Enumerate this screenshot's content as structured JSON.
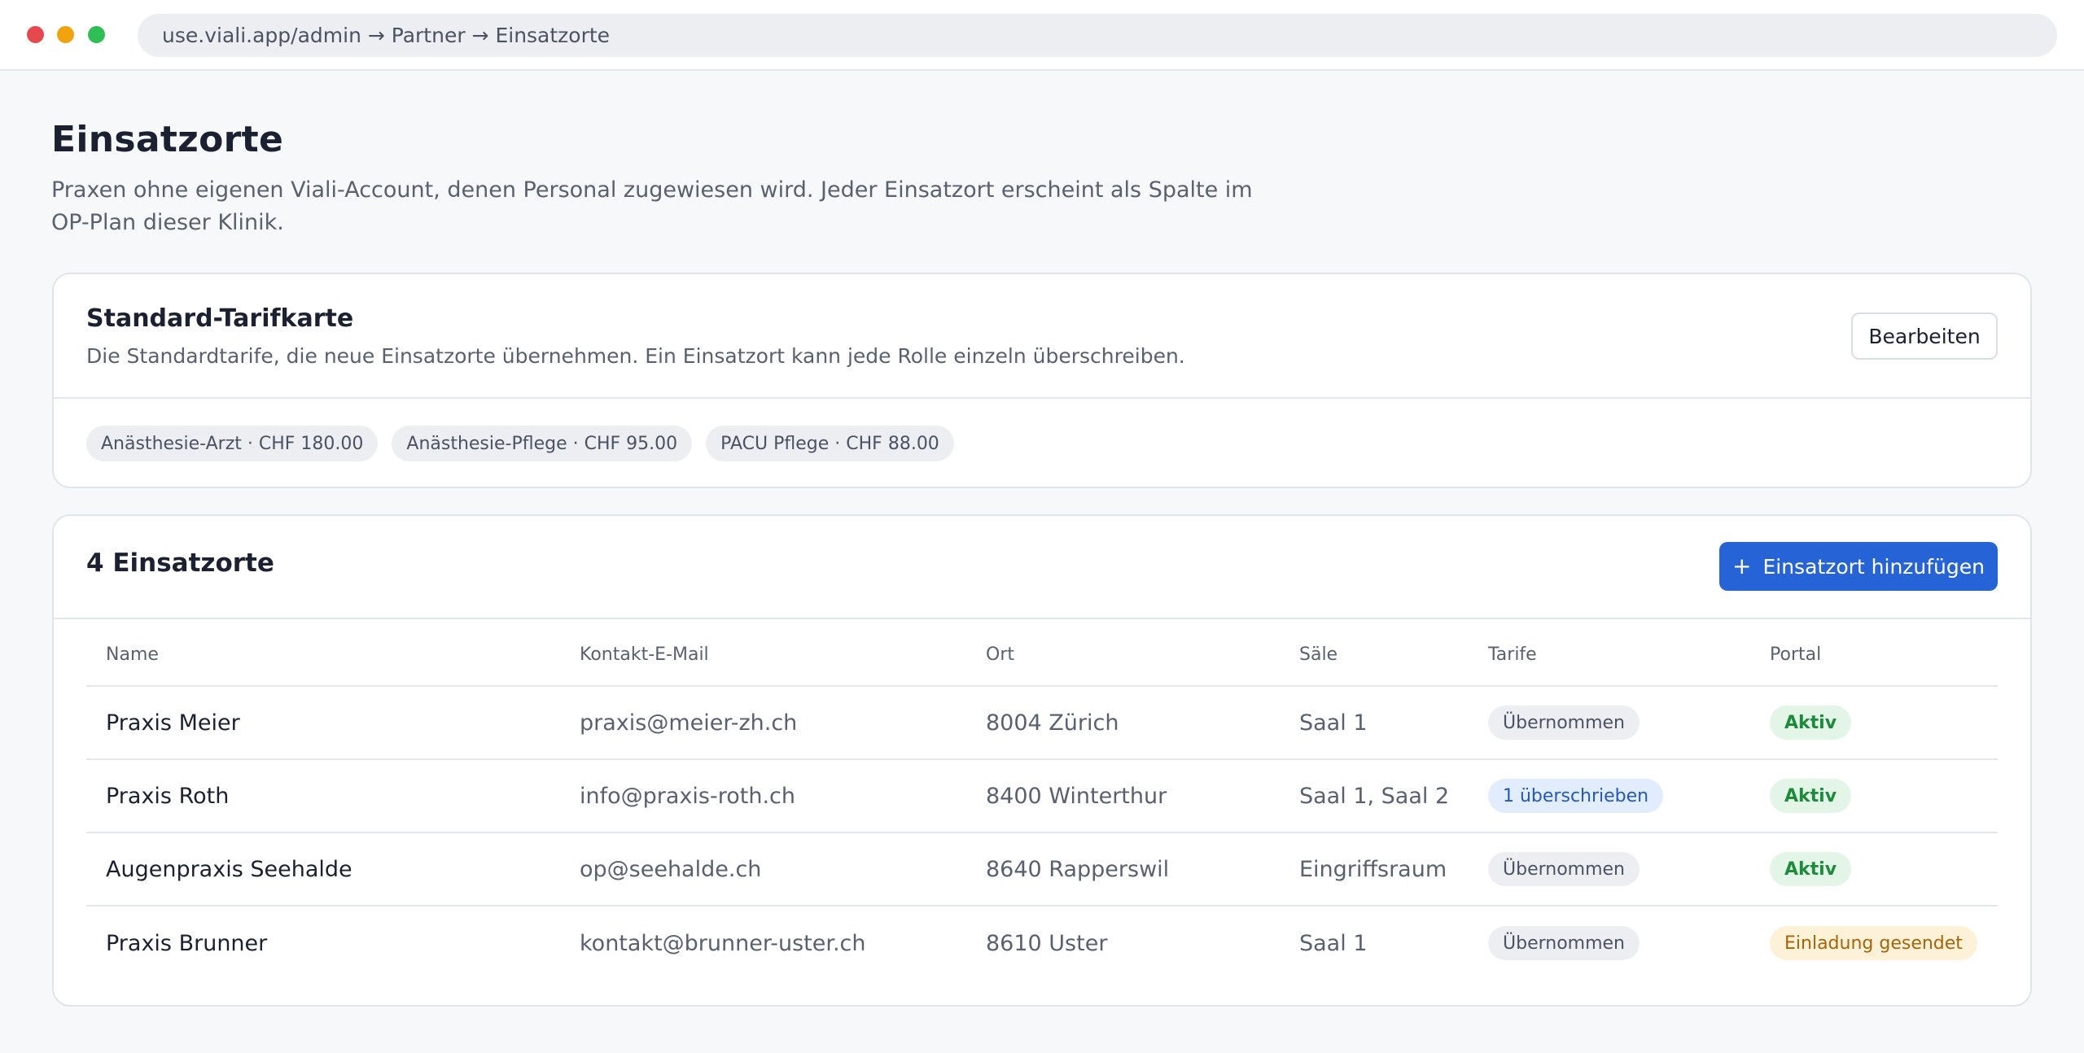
{
  "browser": {
    "url_text": "use.viali.app/admin → Partner → Einsatzorte"
  },
  "page": {
    "title": "Einsatzorte",
    "description": "Praxen ohne eigenen Viali-Account, denen Personal zugewiesen wird. Jeder Einsatzort erscheint als Spalte im OP-Plan dieser Klinik."
  },
  "tariff_card": {
    "title": "Standard-Tarifkarte",
    "description": "Die Standardtarife, die neue Einsatzorte übernehmen. Ein Einsatzort kann jede Rolle einzeln überschreiben.",
    "edit_label": "Bearbeiten",
    "chips": [
      "Anästhesie-Arzt · CHF 180.00",
      "Anästhesie-Pflege · CHF 95.00",
      "PACU Pflege · CHF 88.00"
    ]
  },
  "locations_card": {
    "title": "4 Einsatzorte",
    "add_icon": "plus-icon",
    "add_label": "Einsatzort hinzufügen",
    "columns": [
      "Name",
      "Kontakt-E-Mail",
      "Ort",
      "Säle",
      "Tarife",
      "Portal"
    ],
    "rows": [
      {
        "name": "Praxis Meier",
        "email": "praxis@meier-zh.ch",
        "ort": "8004 Zürich",
        "saele": "Saal 1",
        "tarife": "Übernommen",
        "portal": "Aktiv"
      },
      {
        "name": "Praxis Roth",
        "email": "info@praxis-roth.ch",
        "ort": "8400 Winterthur",
        "saele": "Saal 1, Saal 2",
        "tarife": "1 überschrieben",
        "portal": "Aktiv"
      },
      {
        "name": "Augenpraxis Seehalde",
        "email": "op@seehalde.ch",
        "ort": "8640 Rapperswil",
        "saele": "Eingriffsraum",
        "tarife": "Übernommen",
        "portal": "Aktiv"
      },
      {
        "name": "Praxis Brunner",
        "email": "kontakt@brunner-uster.ch",
        "ort": "8610 Uster",
        "saele": "Saal 1",
        "tarife": "Übernommen",
        "portal": "Einladung gesendet"
      }
    ]
  },
  "colors": {
    "primary": "#2563d6",
    "active_text": "#1e8a3c",
    "pending_text": "#a8640a",
    "override_text": "#2459b8"
  }
}
